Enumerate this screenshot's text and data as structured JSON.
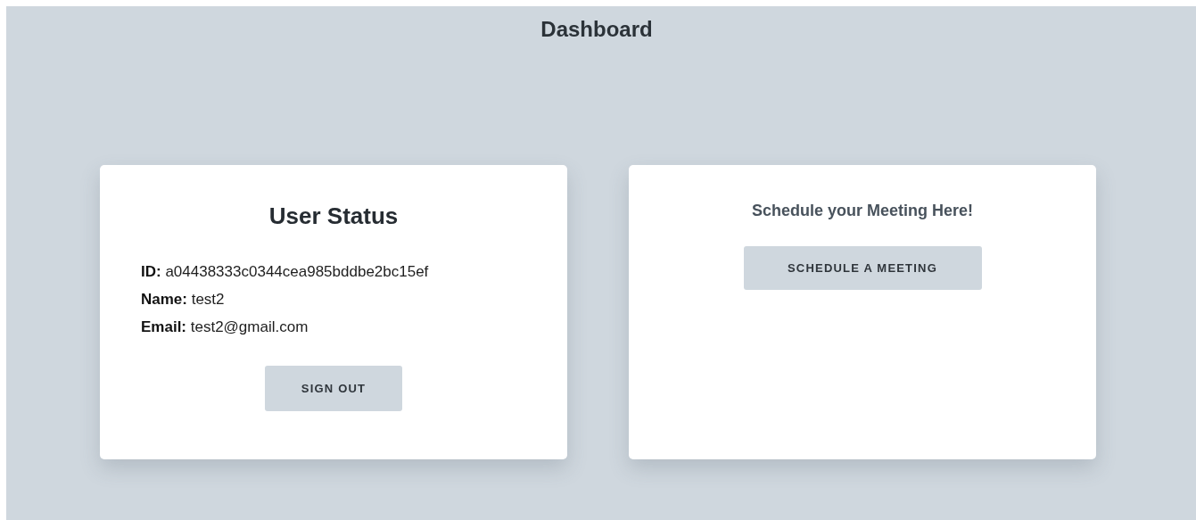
{
  "page": {
    "title": "Dashboard"
  },
  "user_status": {
    "title": "User Status",
    "fields": [
      {
        "text": "**ID:** a04438333c0344cea985bddbe2bc15ef"
      },
      {
        "text": "**Name:** test2"
      },
      {
        "text": "**Email:** test2@gmail.com"
      }
    ],
    "button": "SIGN OUT"
  },
  "meeting": {
    "title": "Schedule your Meeting Here!",
    "button": "SCHEDULE A MEETING"
  }
}
